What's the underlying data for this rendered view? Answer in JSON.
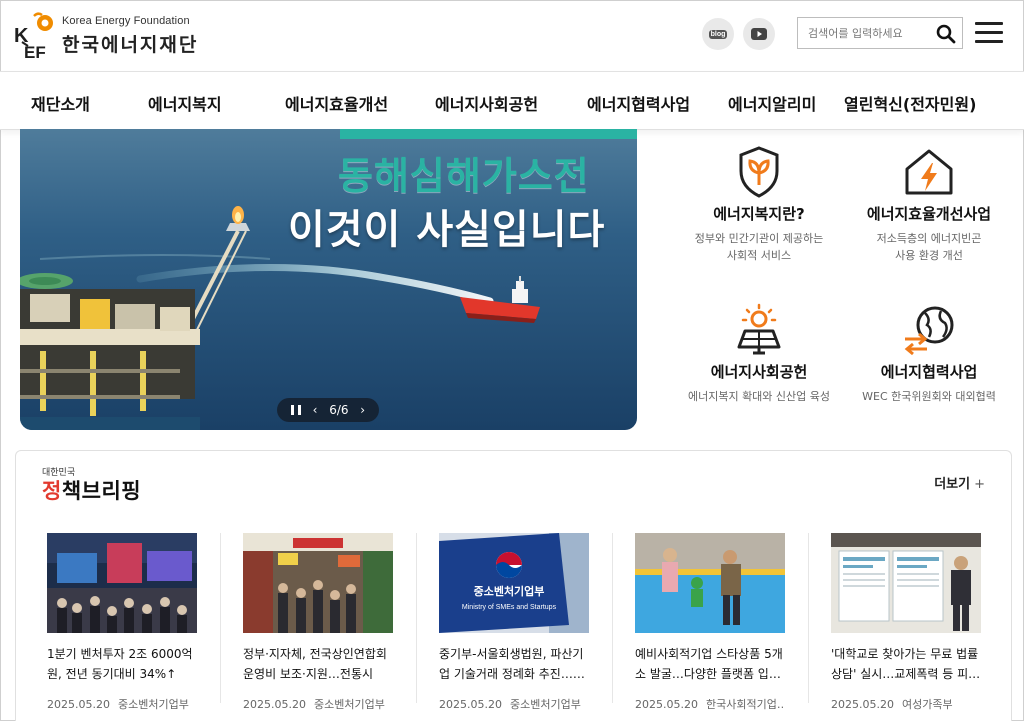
{
  "header": {
    "logo_en": "Korea Energy Foundation",
    "logo_ko": "한국에너지재단",
    "blog_label": "blog",
    "search_placeholder": "검색어를 입력하세요",
    "brand_orange": "#f08c00",
    "brand_red": "#e23a2f"
  },
  "nav": {
    "items": [
      {
        "label": "재단소개"
      },
      {
        "label": "에너지복지"
      },
      {
        "label": "에너지효율개선"
      },
      {
        "label": "에너지사회공헌"
      },
      {
        "label": "에너지협력사업"
      },
      {
        "label": "에너지알리미"
      },
      {
        "label": "열린혁신(전자민원)"
      }
    ]
  },
  "hero": {
    "title_line1": "동해심해가스전",
    "title_line2": "이것이 사실입니다",
    "pager": "6/6",
    "prev_icon": "‹",
    "next_icon": "›"
  },
  "quick_links": [
    {
      "title": "에너지복지란?",
      "desc1": "정부와 민간기관이 제공하는",
      "desc2": "사회적 서비스",
      "icon": "shield-leaf-icon"
    },
    {
      "title": "에너지효율개선사업",
      "desc1": "저소득층의 에너지빈곤",
      "desc2": "사용 환경 개선",
      "icon": "house-bolt-icon"
    },
    {
      "title": "에너지사회공헌",
      "desc1": "에너지복지 확대와 신산업 육성",
      "desc2": "",
      "icon": "solar-panel-icon"
    },
    {
      "title": "에너지협력사업",
      "desc1": "WEC 한국위원회와 대외협력",
      "desc2": "",
      "icon": "globe-exchange-icon"
    }
  ],
  "briefing": {
    "small_label": "대한민국",
    "title_red": "정",
    "title_rest": "책브리핑",
    "more_label": "더보기",
    "more_icon": "+",
    "cards": [
      {
        "title": "1분기 벤처투자 2조 6000억원, 전년 동기대비 34%↑",
        "date": "2025.05.20",
        "source": "중소벤처기업부"
      },
      {
        "title": "정부·지자체, 전국상인연합회 운영비 보조·지원…전통시장…",
        "date": "2025.05.20",
        "source": "중소벤처기업부"
      },
      {
        "title": "중기부-서울회생법원, 파산기업 기술거래 정례화 추진……",
        "date": "2025.05.20",
        "source": "중소벤처기업부"
      },
      {
        "title": "예비사회적기업 스타상품 5개소 발굴…다양한 플랫폼 입…",
        "date": "2025.05.20",
        "source": "한국사회적기업…"
      },
      {
        "title": "'대학교로 찾아가는 무료 법률상담' 실시…교제폭력 등 피…",
        "date": "2025.05.20",
        "source": "여성가족부"
      }
    ],
    "card3_sign_ko": "중소벤처기업부",
    "card3_sign_en": "Ministry of SMEs and Startups"
  }
}
